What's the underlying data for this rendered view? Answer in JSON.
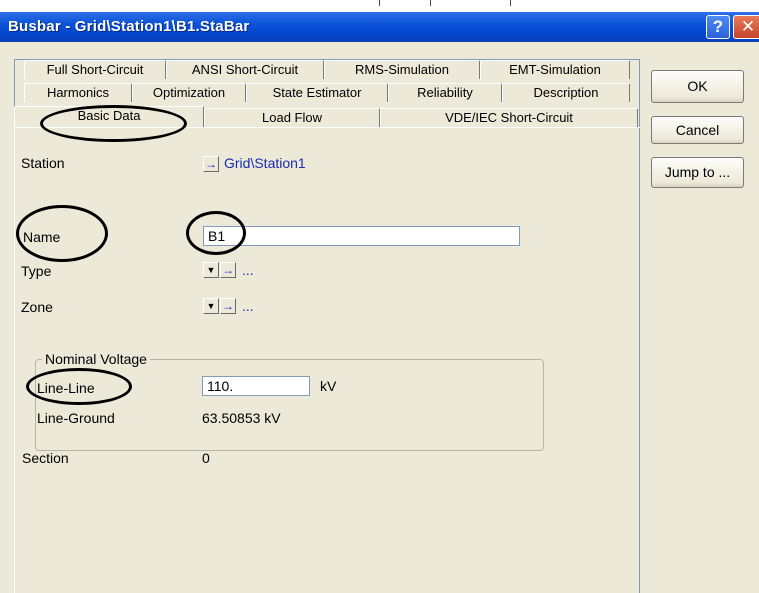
{
  "window": {
    "title": "Busbar - Grid\\Station1\\B1.StaBar",
    "help_label": "?",
    "close_label": "✕"
  },
  "tabs": {
    "row1": [
      "Full Short-Circuit",
      "ANSI Short-Circuit",
      "RMS-Simulation",
      "EMT-Simulation"
    ],
    "row2": [
      "Harmonics",
      "Optimization",
      "State Estimator",
      "Reliability",
      "Description"
    ],
    "row3": [
      "Basic Data",
      "Load Flow",
      "VDE/IEC Short-Circuit"
    ],
    "active": "Basic Data"
  },
  "form": {
    "station_label": "Station",
    "station_value": "Grid\\Station1",
    "name_label": "Name",
    "name_value": "B1",
    "type_label": "Type",
    "type_value": "...",
    "zone_label": "Zone",
    "zone_value": "...",
    "nominal_voltage_group": "Nominal Voltage",
    "line_line_label": "Line-Line",
    "line_line_value": "110.",
    "line_line_unit": "kV",
    "line_ground_label": "Line-Ground",
    "line_ground_value": "63.50853 kV",
    "section_label": "Section",
    "section_value": "0"
  },
  "buttons": {
    "ok": "OK",
    "cancel": "Cancel",
    "jump_to": "Jump to ..."
  },
  "icons": {
    "arrow": "→",
    "dropdown": "▼"
  }
}
